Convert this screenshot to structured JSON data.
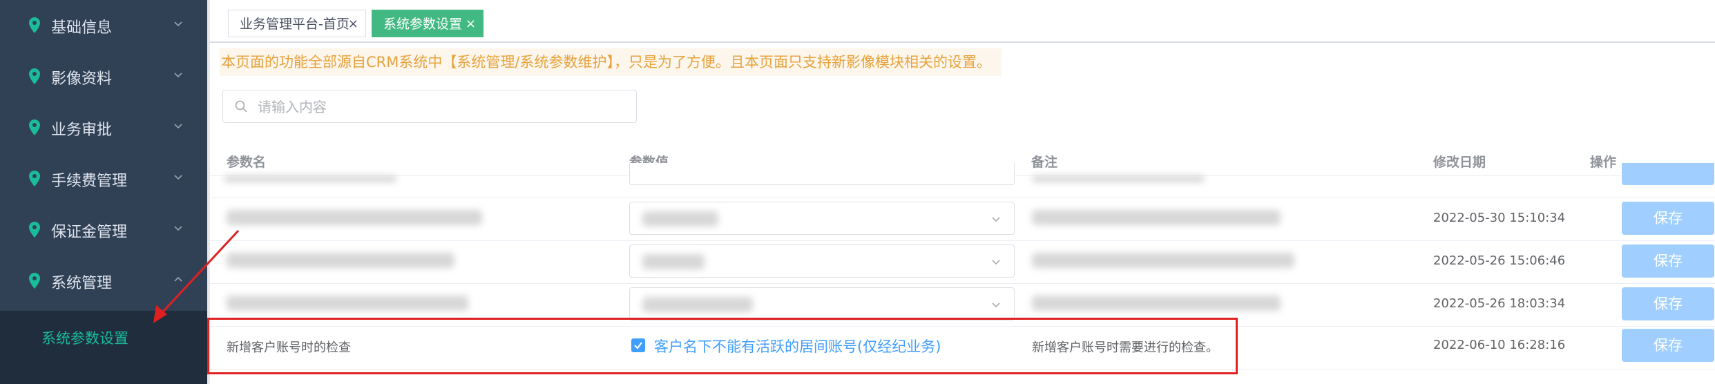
{
  "sidebar": {
    "items": [
      {
        "label": "基础信息"
      },
      {
        "label": "影像资料"
      },
      {
        "label": "业务审批"
      },
      {
        "label": "手续费管理"
      },
      {
        "label": "保证金管理"
      },
      {
        "label": "系统管理"
      }
    ],
    "sub_item": {
      "label": "系统参数设置"
    }
  },
  "tabs": [
    {
      "label": "业务管理平台-首页",
      "close": "×"
    },
    {
      "label": "系统参数设置",
      "close": "×"
    }
  ],
  "notice": "本页面的功能全部源自CRM系统中【系统管理/系统参数维护】，只是为了方便。且本页面只支持新影像模块相关的设置。",
  "search": {
    "placeholder": "请输入内容",
    "value": ""
  },
  "table": {
    "headers": [
      "参数名",
      "参数值",
      "备注",
      "修改日期",
      "操作"
    ],
    "rows": [
      {
        "date": "2022-05-30 15:10:34",
        "action": "保存"
      },
      {
        "date": "2022-05-26 15:06:46",
        "action": "保存"
      },
      {
        "date": "2022-05-26 18:03:34",
        "action": "保存"
      },
      {
        "name": "新增客户账号时的检查",
        "value": "客户名下不能有活跃的居间账号(仅经纪业务)",
        "checked": true,
        "remark": "新增客户账号时需要进行的检查。",
        "date": "2022-06-10 16:28:16",
        "action": "保存"
      }
    ]
  },
  "colors": {
    "sidebar_bg": "#304156",
    "active_tab": "#42b983",
    "accent": "#409eff",
    "highlight_box": "#e02020",
    "arrow": "#e02020"
  }
}
